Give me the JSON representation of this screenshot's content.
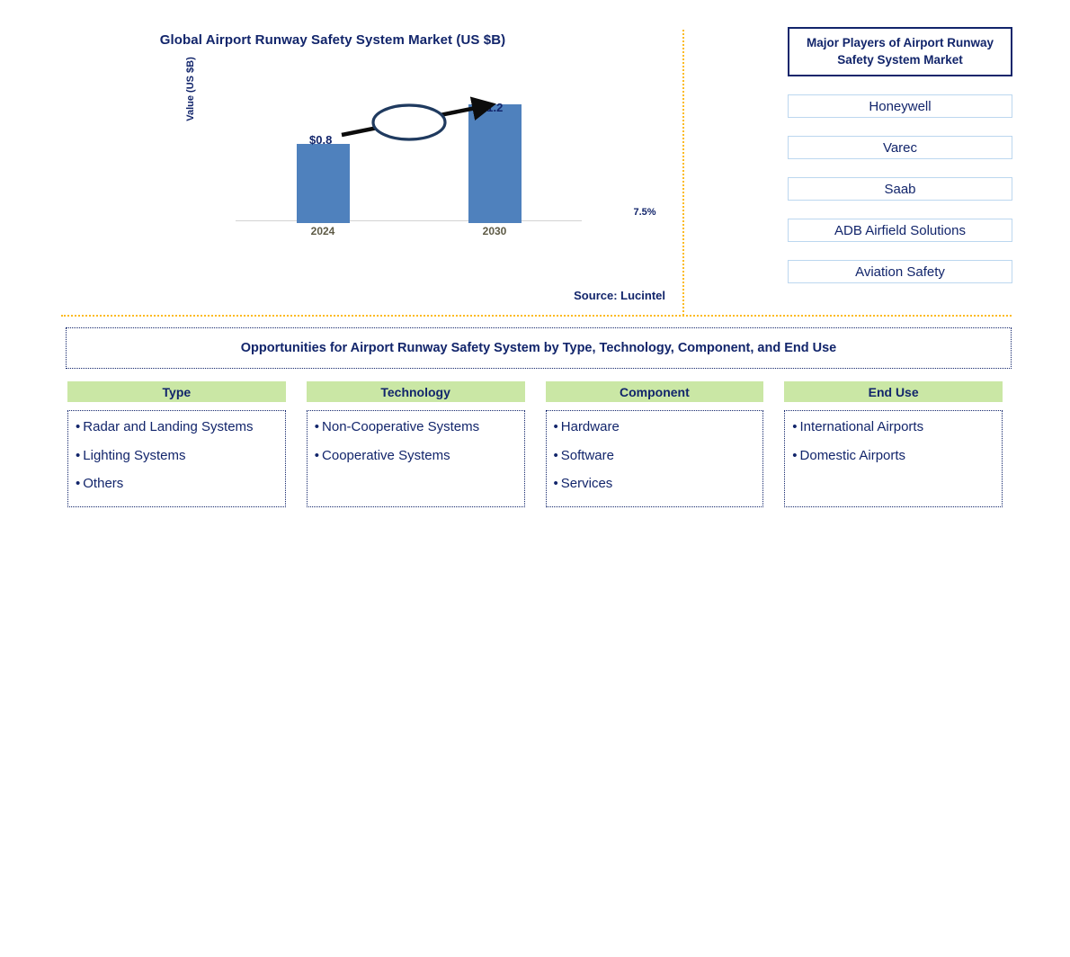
{
  "chart_panel": {
    "title": "Global Airport Runway Safety System Market (US $B)",
    "y_axis_label": "Value (US $B)",
    "source": "Source: Lucintel"
  },
  "chart_data": {
    "type": "bar",
    "title": "Global Airport Runway Safety System Market (US $B)",
    "categories": [
      "2024",
      "2030"
    ],
    "values": [
      0.8,
      1.2
    ],
    "value_labels": [
      "$0.8",
      "$1.2"
    ],
    "xlabel": "",
    "ylabel": "Value (US $B)",
    "ylim": [
      0,
      1.35
    ],
    "grid": false,
    "legend": "none",
    "bar_color": "#4f81bd",
    "annotations": [
      {
        "text": "7.5%",
        "type": "cagr-ellipse-callout",
        "from": "2024",
        "to": "2030"
      }
    ]
  },
  "players": {
    "header": "Major Players of Airport Runway Safety System Market",
    "items": [
      "Honeywell",
      "Varec",
      "Saab",
      "ADB Airfield Solutions",
      "Aviation Safety"
    ]
  },
  "opportunities": {
    "banner": "Opportunities for Airport Runway Safety System by Type, Technology, Component, and End Use",
    "columns": [
      {
        "header": "Type",
        "items": [
          "Radar and Landing Systems",
          "Lighting Systems",
          "Others"
        ]
      },
      {
        "header": "Technology",
        "items": [
          "Non-Cooperative Systems",
          "Cooperative Systems"
        ]
      },
      {
        "header": "Component",
        "items": [
          "Hardware",
          "Software",
          "Services"
        ]
      },
      {
        "header": "End Use",
        "items": [
          "International Airports",
          "Domestic Airports"
        ]
      }
    ]
  },
  "colors": {
    "navy": "#12256b",
    "bar_blue": "#4f81bd",
    "header_green": "#cae7a5",
    "divider_orange": "#fcbb21",
    "player_border": "#bcd7ef"
  },
  "bullet": "•"
}
